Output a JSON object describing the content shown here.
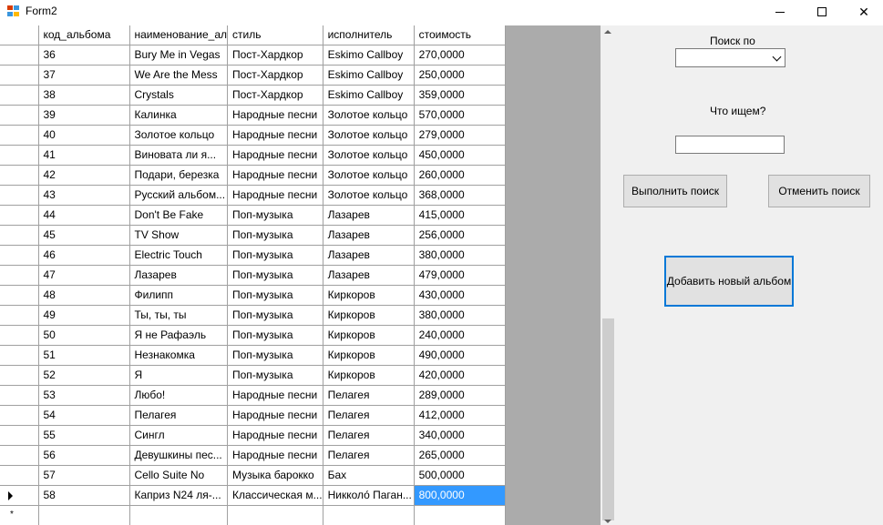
{
  "window": {
    "title": "Form2",
    "icon": "form-app-icon",
    "controls": {
      "minimize": "minimize-icon",
      "maximize": "maximize-icon",
      "close": "✕"
    }
  },
  "grid": {
    "columns": [
      "код_альбома",
      "наименование_ал",
      "стиль",
      "исполнитель",
      "стоимость"
    ],
    "rows": [
      [
        "36",
        "Bury Me in Vegas",
        "Пост-Хардкор",
        "Eskimo Callboy",
        "270,0000"
      ],
      [
        "37",
        "We Are the Mess",
        "Пост-Хардкор",
        "Eskimo Callboy",
        "250,0000"
      ],
      [
        "38",
        "Crystals",
        "Пост-Хардкор",
        "Eskimo Callboy",
        "359,0000"
      ],
      [
        "39",
        "Калинка",
        "Народные песни",
        "Золотое кольцо",
        "570,0000"
      ],
      [
        "40",
        "Золотое кольцо",
        "Народные песни",
        "Золотое кольцо",
        "279,0000"
      ],
      [
        "41",
        "Виновата ли я...",
        "Народные песни",
        "Золотое кольцо",
        "450,0000"
      ],
      [
        "42",
        "Подари, березка",
        "Народные песни",
        "Золотое кольцо",
        "260,0000"
      ],
      [
        "43",
        "Русский альбом...",
        "Народные песни",
        "Золотое кольцо",
        "368,0000"
      ],
      [
        "44",
        " Don't Be Fake",
        "Поп-музыка",
        "Лазарев",
        "415,0000"
      ],
      [
        "45",
        " TV Show",
        "Поп-музыка",
        "Лазарев",
        "256,0000"
      ],
      [
        "46",
        " Electric Touch",
        "Поп-музыка",
        "Лазарев",
        "380,0000"
      ],
      [
        "47",
        "Лазарев",
        "Поп-музыка",
        "Лазарев",
        "479,0000"
      ],
      [
        "48",
        "Филипп",
        "Поп-музыка",
        "Киркоров",
        "430,0000"
      ],
      [
        "49",
        "Ты, ты, ты",
        "Поп-музыка",
        "Киркоров",
        "380,0000"
      ],
      [
        "50",
        "Я не Рафаэль",
        "Поп-музыка",
        "Киркоров",
        "240,0000"
      ],
      [
        "51",
        "Незнакомка",
        "Поп-музыка",
        "Киркоров",
        "490,0000"
      ],
      [
        "52",
        "Я",
        "Поп-музыка",
        "Киркоров",
        "420,0000"
      ],
      [
        "53",
        "Любо!",
        "Народные песни",
        "Пелагея",
        "289,0000"
      ],
      [
        "54",
        "Пелагея",
        "Народные песни",
        "Пелагея",
        "412,0000"
      ],
      [
        "55",
        "Сингл",
        "Народные песни",
        "Пелагея",
        "340,0000"
      ],
      [
        "56",
        "Девушкины пес...",
        "Народные песни",
        "Пелагея",
        "265,0000"
      ],
      [
        "57",
        "Cello Suite No",
        "Музыка барокко",
        "Бах",
        "500,0000"
      ],
      [
        "58",
        "Каприз N24 ля-...",
        "Классическая м...",
        "Никколо́ Паган...",
        "800,0000"
      ]
    ],
    "current_row_marker": "row-arrow-icon",
    "new_row_marker": "*",
    "selected_color": "#3399ff"
  },
  "panel": {
    "search_by_label": "Поиск по",
    "search_by_value": "",
    "what_label": "Что ищем?",
    "search_text_value": "",
    "search_button": "Выполнить поиск",
    "cancel_button": "Отменить поиск",
    "add_button": "Добавить новый альбом"
  }
}
